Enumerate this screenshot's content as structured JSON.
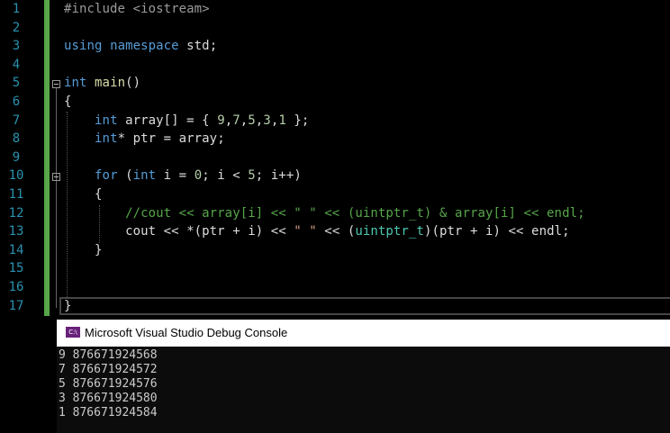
{
  "editor": {
    "line_numbers": [
      "1",
      "2",
      "3",
      "4",
      "5",
      "6",
      "7",
      "8",
      "9",
      "10",
      "11",
      "12",
      "13",
      "14",
      "15",
      "16",
      "17"
    ],
    "lines": [
      [
        {
          "t": "#include <iostream>",
          "c": "inc"
        }
      ],
      [],
      [
        {
          "t": "using",
          "c": "kw"
        },
        {
          "t": " ",
          "c": "id"
        },
        {
          "t": "namespace",
          "c": "kw"
        },
        {
          "t": " std;",
          "c": "id"
        }
      ],
      [],
      [
        {
          "t": "int",
          "c": "kw"
        },
        {
          "t": " ",
          "c": "id"
        },
        {
          "t": "main",
          "c": "fn"
        },
        {
          "t": "()",
          "c": "id"
        }
      ],
      [
        {
          "t": "{",
          "c": "id"
        }
      ],
      [
        {
          "t": "    ",
          "c": "id"
        },
        {
          "t": "int",
          "c": "kw"
        },
        {
          "t": " array[] = { ",
          "c": "id"
        },
        {
          "t": "9",
          "c": "num"
        },
        {
          "t": ",",
          "c": "id"
        },
        {
          "t": "7",
          "c": "num"
        },
        {
          "t": ",",
          "c": "id"
        },
        {
          "t": "5",
          "c": "num"
        },
        {
          "t": ",",
          "c": "id"
        },
        {
          "t": "3",
          "c": "num"
        },
        {
          "t": ",",
          "c": "id"
        },
        {
          "t": "1",
          "c": "num"
        },
        {
          "t": " };",
          "c": "id"
        }
      ],
      [
        {
          "t": "    ",
          "c": "id"
        },
        {
          "t": "int",
          "c": "kw"
        },
        {
          "t": "* ptr = array;",
          "c": "id"
        }
      ],
      [],
      [
        {
          "t": "    ",
          "c": "id"
        },
        {
          "t": "for",
          "c": "kw"
        },
        {
          "t": " (",
          "c": "id"
        },
        {
          "t": "int",
          "c": "kw"
        },
        {
          "t": " i = ",
          "c": "id"
        },
        {
          "t": "0",
          "c": "num"
        },
        {
          "t": "; i < ",
          "c": "id"
        },
        {
          "t": "5",
          "c": "num"
        },
        {
          "t": "; i++)",
          "c": "id"
        }
      ],
      [
        {
          "t": "    {",
          "c": "id"
        }
      ],
      [
        {
          "t": "        //cout << array[i] << \" \" << (uintptr_t) & array[i] << endl;",
          "c": "cmt"
        }
      ],
      [
        {
          "t": "        cout << *(ptr + i) << ",
          "c": "id"
        },
        {
          "t": "\" \"",
          "c": "str"
        },
        {
          "t": " << (",
          "c": "id"
        },
        {
          "t": "uintptr_t",
          "c": "ty"
        },
        {
          "t": ")(ptr + i) << endl;",
          "c": "id"
        }
      ],
      [
        {
          "t": "    }",
          "c": "id"
        }
      ],
      [],
      [],
      [
        {
          "t": "}",
          "c": "id"
        }
      ]
    ]
  },
  "console": {
    "title": "Microsoft Visual Studio Debug Console",
    "icon": "console-app-icon",
    "icon_text": "C:\\",
    "output": [
      "9 876671924568",
      "7 876671924572",
      "5 876671924576",
      "3 876671924580",
      "1 876671924584"
    ]
  },
  "colors": {
    "background": "#000000",
    "keyword": "#569cd6",
    "type": "#4ec9b0",
    "number": "#b5cea8",
    "string": "#d69d85",
    "comment": "#57a64a",
    "line_number": "#2b91af",
    "change_margin": "#57a64a"
  }
}
